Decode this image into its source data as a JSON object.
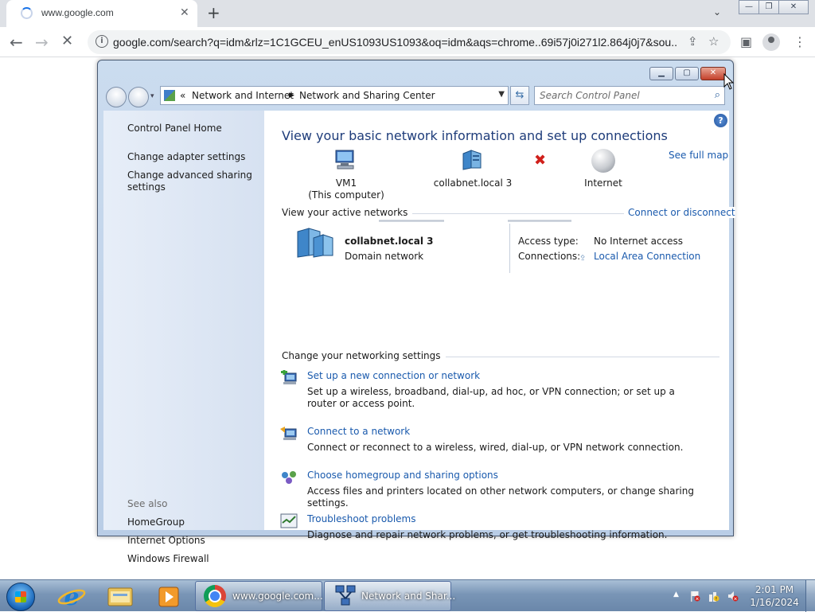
{
  "browser": {
    "tab_title": "www.google.com",
    "url": "google.com/search?q=idm&rlz=1C1GCEU_enUS1093US1093&oq=idm&aqs=chrome..69i57j0i271l2.864j0j7&sou...",
    "icons": [
      "back-icon",
      "forward-icon",
      "stop-icon",
      "info-icon",
      "share-icon",
      "star-icon",
      "side-panel-icon",
      "profile-icon",
      "menu-icon"
    ]
  },
  "window": {
    "address": {
      "chevrons": "«",
      "crumb1": "Network and Internet",
      "crumb2": "Network and Sharing Center"
    },
    "search_placeholder": "Search Control Panel",
    "sidebar": {
      "links": [
        "Control Panel Home",
        "Change adapter settings",
        "Change advanced sharing settings"
      ],
      "see_also": "See also",
      "see_also_links": [
        "HomeGroup",
        "Internet Options",
        "Windows Firewall"
      ]
    },
    "main": {
      "heading": "View your basic network information and set up connections",
      "see_full_map": "See full map",
      "nodes": {
        "computer_name": "VM1",
        "computer_sub": "(This computer)",
        "network": "collabnet.local  3",
        "internet": "Internet"
      },
      "active_networks_title": "View your active networks",
      "connect_disconnect": "Connect or disconnect",
      "active_network": {
        "name": "collabnet.local  3",
        "type": "Domain network",
        "access_label": "Access type:",
        "access_value": "No Internet access",
        "connections_label": "Connections:",
        "connections_value": "Local Area Connection"
      },
      "settings_title": "Change your networking settings",
      "tasks": [
        {
          "title": "Set up a new connection or network",
          "desc": "Set up a wireless, broadband, dial-up, ad hoc, or VPN connection; or set up a router or access point."
        },
        {
          "title": "Connect to a network",
          "desc": "Connect or reconnect to a wireless, wired, dial-up, or VPN network connection."
        },
        {
          "title": "Choose homegroup and sharing options",
          "desc": "Access files and printers located on other network computers, or change sharing settings."
        },
        {
          "title": "Troubleshoot problems",
          "desc": "Diagnose and repair network problems, or get troubleshooting information."
        }
      ]
    }
  },
  "taskbar": {
    "chrome_label": "www.google.com...",
    "network_label": "Network and Shar...",
    "time": "2:01 PM",
    "date": "1/16/2024"
  },
  "colors": {
    "link": "#1a5aad",
    "heading": "#1e3c7a",
    "error_x": "#d0201b"
  }
}
